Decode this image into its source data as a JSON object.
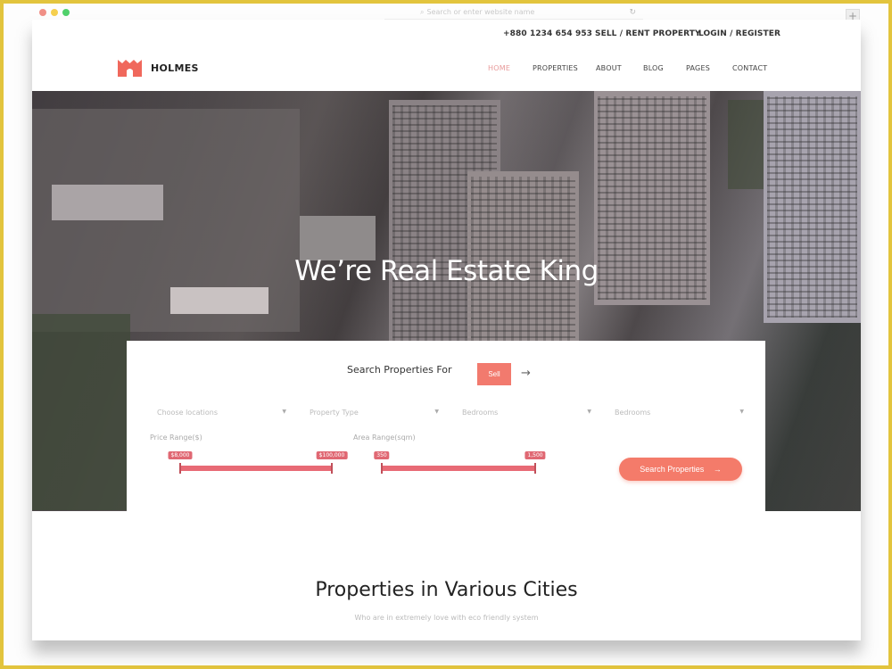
{
  "browser": {
    "address_placeholder": "Search or enter website name",
    "new_tab_label": "+"
  },
  "topbar": {
    "phone": "+880 1234 654 953",
    "sell_rent": "SELL / RENT PROPERTY",
    "login_register": "LOGIN / REGISTER"
  },
  "brand": {
    "name": "HOLMES",
    "accent_color": "#f27a6e"
  },
  "nav": {
    "items": [
      {
        "label": "HOME",
        "active": true
      },
      {
        "label": "PROPERTIES",
        "active": false
      },
      {
        "label": "ABOUT",
        "active": false
      },
      {
        "label": "BLOG",
        "active": false
      },
      {
        "label": "PAGES",
        "active": false
      },
      {
        "label": "CONTACT",
        "active": false
      }
    ]
  },
  "hero": {
    "title": "We’re Real Estate King"
  },
  "search": {
    "label": "Search Properties For",
    "mode_button": "Sell",
    "dropdowns": [
      {
        "placeholder": "Choose locations"
      },
      {
        "placeholder": "Property Type"
      },
      {
        "placeholder": "Bedrooms"
      },
      {
        "placeholder": "Bedrooms"
      }
    ],
    "price_range": {
      "label": "Price Range($)",
      "min_label": "$8,000",
      "max_label": "$100,000",
      "min_fraction": 0.0,
      "max_fraction": 1.0
    },
    "area_range": {
      "label": "Area Range(sqm)",
      "min_label": "350",
      "max_label": "1,500",
      "min_fraction": 0.0,
      "max_fraction": 1.0
    },
    "submit_label": "Search Properties",
    "submit_icon": "arrow-right-icon"
  },
  "section": {
    "title": "Properties in Various Cities",
    "subtitle": "Who are in extremely love with eco friendly system"
  }
}
